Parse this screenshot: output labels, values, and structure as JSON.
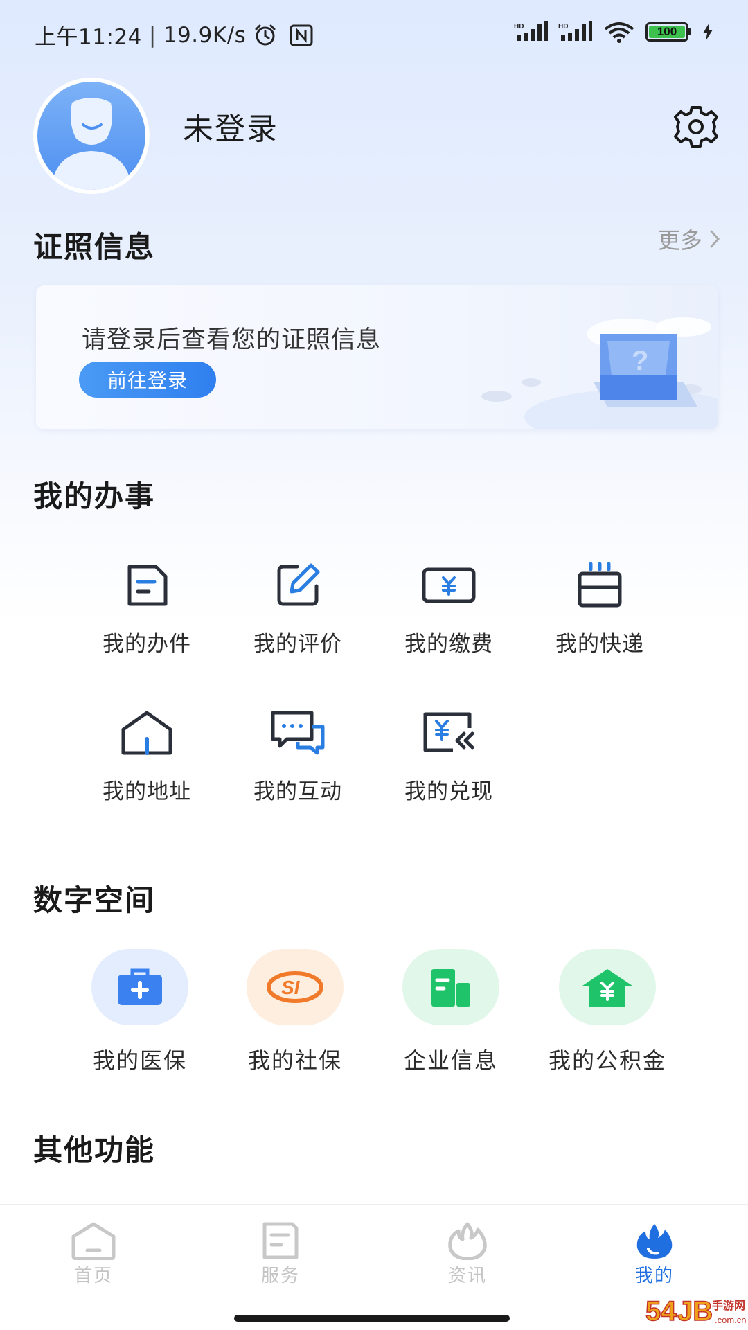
{
  "status_bar": {
    "time": "上午11:24",
    "speed": "19.9K/s",
    "battery": "100"
  },
  "profile": {
    "username": "未登录"
  },
  "license": {
    "title": "证照信息",
    "more": "更多",
    "message": "请登录后查看您的证照信息",
    "login_button": "前往登录"
  },
  "affairs": {
    "title": "我的办事",
    "items": [
      {
        "label": "我的办件",
        "icon": "document-icon"
      },
      {
        "label": "我的评价",
        "icon": "edit-icon"
      },
      {
        "label": "我的缴费",
        "icon": "payment-icon"
      },
      {
        "label": "我的快递",
        "icon": "package-icon"
      },
      {
        "label": "我的地址",
        "icon": "house-icon"
      },
      {
        "label": "我的互动",
        "icon": "chat-icon"
      },
      {
        "label": "我的兑现",
        "icon": "redeem-icon"
      }
    ]
  },
  "digital_space": {
    "title": "数字空间",
    "items": [
      {
        "label": "我的医保",
        "icon": "medical-kit-icon",
        "color": "#3b82f0"
      },
      {
        "label": "我的社保",
        "icon": "social-security-icon",
        "color": "#f07a2a"
      },
      {
        "label": "企业信息",
        "icon": "building-icon",
        "color": "#1fc46a"
      },
      {
        "label": "我的公积金",
        "icon": "housing-fund-icon",
        "color": "#1fc46a"
      }
    ]
  },
  "other": {
    "title": "其他功能"
  },
  "bottom_nav": {
    "items": [
      {
        "label": "首页",
        "icon": "home-icon"
      },
      {
        "label": "服务",
        "icon": "service-icon"
      },
      {
        "label": "资讯",
        "icon": "flame-icon"
      },
      {
        "label": "我的",
        "icon": "flame-filled-icon",
        "active": true
      }
    ]
  },
  "watermark": {
    "text": "54JB手游网",
    "domain": ".com.cn"
  },
  "colors": {
    "accent": "#1f6fe0",
    "button": "#2f7ff0"
  }
}
